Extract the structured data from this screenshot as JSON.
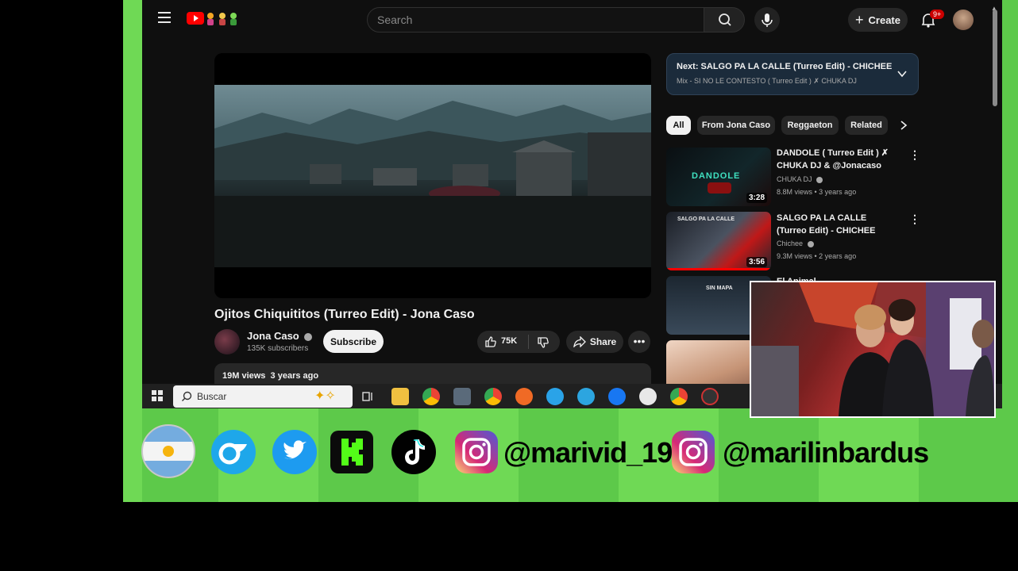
{
  "topbar": {
    "search_placeholder": "Search",
    "create_label": "Create",
    "notification_badge": "9+"
  },
  "video": {
    "title": "Ojitos Chiquititos (Turreo Edit) - Jona Caso",
    "channel": "Jona Caso",
    "subscribers": "135K subscribers",
    "subscribe_label": "Subscribe",
    "likes": "75K",
    "share_label": "Share",
    "views": "19M views",
    "age": "3 years ago"
  },
  "next_panel": {
    "title": "Next: SALGO PA LA CALLE (Turreo Edit) - CHICHEE",
    "subtitle": "Mix - SI NO LE CONTESTO ( Turreo Edit ) ✗ CHUKA DJ"
  },
  "chips": [
    "All",
    "From Jona Caso",
    "Reggaeton",
    "Related"
  ],
  "recommendations": [
    {
      "title": "DANDOLE ( Turreo Edit ) ✗ CHUKA DJ & @Jonacaso",
      "channel": "CHUKA DJ",
      "meta": "8.8M views • 3 years ago",
      "duration": "3:28",
      "thumb_text": "DANDOLE"
    },
    {
      "title": "SALGO PA LA CALLE (Turreo Edit) - CHICHEE",
      "channel": "Chichee",
      "meta": "9.3M views • 2 years ago",
      "duration": "3:56",
      "thumb_text": "SALGO PA LA CALLE"
    },
    {
      "title": "El Animal",
      "thumb_text": "SIN MAPA"
    }
  ],
  "taskbar": {
    "search_label": "Buscar"
  },
  "social": {
    "handle_1": "@marivid_19",
    "handle_2": "@marilinbardus"
  },
  "colors": {
    "stream_green": "#5dc94a",
    "yt_bg": "#0f0f0f",
    "chip_bg": "#272727",
    "next_panel_bg": "#1b2b3b",
    "notif_red": "#cc0000"
  }
}
